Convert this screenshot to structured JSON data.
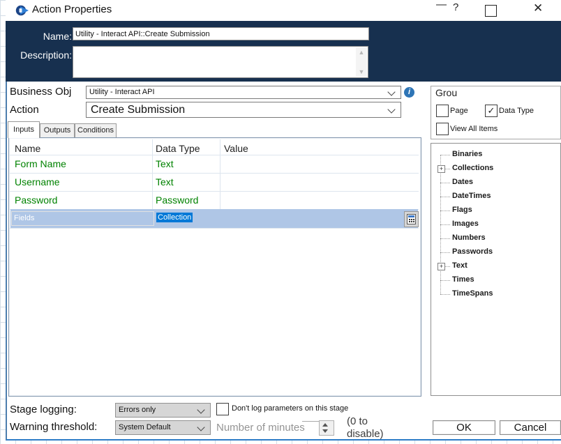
{
  "window": {
    "title": "Action Properties",
    "minimize_glyph": "—",
    "help_glyph": "?",
    "close_glyph": "✕"
  },
  "header": {
    "name_label": "Name:",
    "name_value": "Utility - Interact API::Create Submission",
    "description_label": "Description:",
    "description_value": ""
  },
  "selectors": {
    "business_object_label": "Business Obj",
    "business_object_value": "Utility - Interact API",
    "action_label": "Action",
    "action_value": "Create Submission"
  },
  "tabs": [
    {
      "label": "Inputs",
      "active": true
    },
    {
      "label": "Outputs",
      "active": false
    },
    {
      "label": "Conditions",
      "active": false
    }
  ],
  "inputs_table": {
    "columns": [
      "Name",
      "Data Type",
      "Value"
    ],
    "rows": [
      {
        "name": "Form Name",
        "data_type": "Text",
        "value": "",
        "selected": false
      },
      {
        "name": "Username",
        "data_type": "Text",
        "value": "",
        "selected": false
      },
      {
        "name": "Password",
        "data_type": "Password",
        "value": "",
        "selected": false
      },
      {
        "name": "Fields",
        "data_type": "Collection",
        "value": "",
        "selected": true
      }
    ]
  },
  "group_panel": {
    "title": "Grou",
    "page_label": "Page",
    "page_checked": false,
    "data_type_label": "Data Type",
    "data_type_checked": true,
    "view_all_label": "View All Items",
    "view_all_checked": false,
    "check_glyph": "✓"
  },
  "data_tree": {
    "expand_glyph": "+",
    "items": [
      {
        "label": "Binaries",
        "expandable": false
      },
      {
        "label": "Collections",
        "expandable": true
      },
      {
        "label": "Dates",
        "expandable": false
      },
      {
        "label": "DateTimes",
        "expandable": false
      },
      {
        "label": "Flags",
        "expandable": false
      },
      {
        "label": "Images",
        "expandable": false
      },
      {
        "label": "Numbers",
        "expandable": false
      },
      {
        "label": "Passwords",
        "expandable": false
      },
      {
        "label": "Text",
        "expandable": true
      },
      {
        "label": "Times",
        "expandable": false
      },
      {
        "label": "TimeSpans",
        "expandable": false
      }
    ]
  },
  "footer": {
    "stage_logging_label": "Stage logging:",
    "stage_logging_value": "Errors only",
    "dont_log_label": "Don't log parameters on this stage",
    "dont_log_checked": false,
    "warning_threshold_label": "Warning threshold:",
    "warning_threshold_value": "System Default",
    "number_of_minutes_label": "Number of minutes",
    "disable_hint": "(0 to disable)",
    "ok_label": "OK",
    "cancel_label": "Cancel"
  },
  "colors": {
    "titlebar_navy": "#17304f",
    "parameter_green": "#008200",
    "selection_blue": "#0078d7",
    "selected_row_blue": "#afc6e6",
    "dialog_bottom_border": "#2d7cc7"
  }
}
